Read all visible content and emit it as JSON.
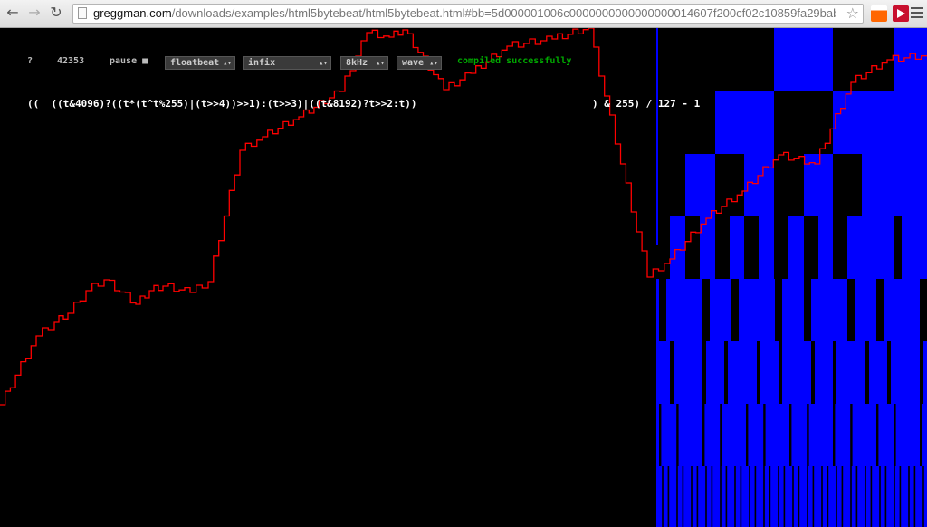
{
  "browser": {
    "back_glyph": "←",
    "forward_glyph": "→",
    "reload_glyph": "↻",
    "url_host": "greggman.com",
    "url_rest": "/downloads/examples/html5bytebeat/html5bytebeat.html#bb=5d000001006c0000000000000000014607f200cf02c10859fa29bab...",
    "star_glyph": "☆"
  },
  "controls": {
    "help": "?",
    "time": "42353",
    "pause": "pause ■",
    "beat_type": "floatbeat",
    "expression_type": "infix",
    "sample_rate": "8kHz",
    "view": "wave",
    "status": "compiled successfully"
  },
  "expression": {
    "left": "((  ((t&4096)?((t*(t^t%255)|(t>>4))>>1):(t>>3)|((t&8192)?t>>2:t))",
    "right": ") & 255) / 127 - 1"
  },
  "colors": {
    "wave": "#ff0000",
    "spectrum": "#0000ff",
    "status": "#00a800",
    "background": "#000000"
  }
}
